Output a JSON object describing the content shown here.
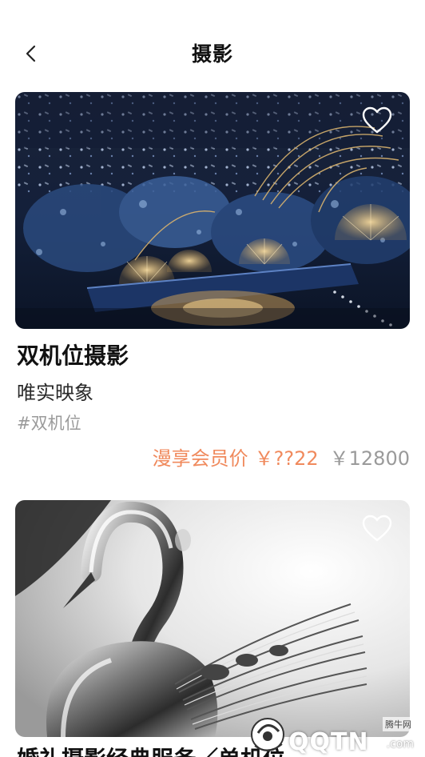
{
  "nav": {
    "back_icon": "chevron-left-icon",
    "title": "摄影"
  },
  "cards": [
    {
      "name": "双机位摄影",
      "studio": "唯实映象",
      "tag": "#双机位",
      "member_label": "漫享会员价",
      "member_price": "￥??22",
      "original_price": "￥12800",
      "favorite_icon": "heart-outline-icon"
    },
    {
      "name": "婚礼摄影经典服务／单机位",
      "favorite_icon": "heart-outline-icon"
    }
  ],
  "watermark": {
    "site_name": "腾牛网",
    "domain": "QQTN",
    "suffix": ".com"
  },
  "colors": {
    "accent": "#f08a5d",
    "muted": "#9a9a9a",
    "title": "#111111"
  }
}
